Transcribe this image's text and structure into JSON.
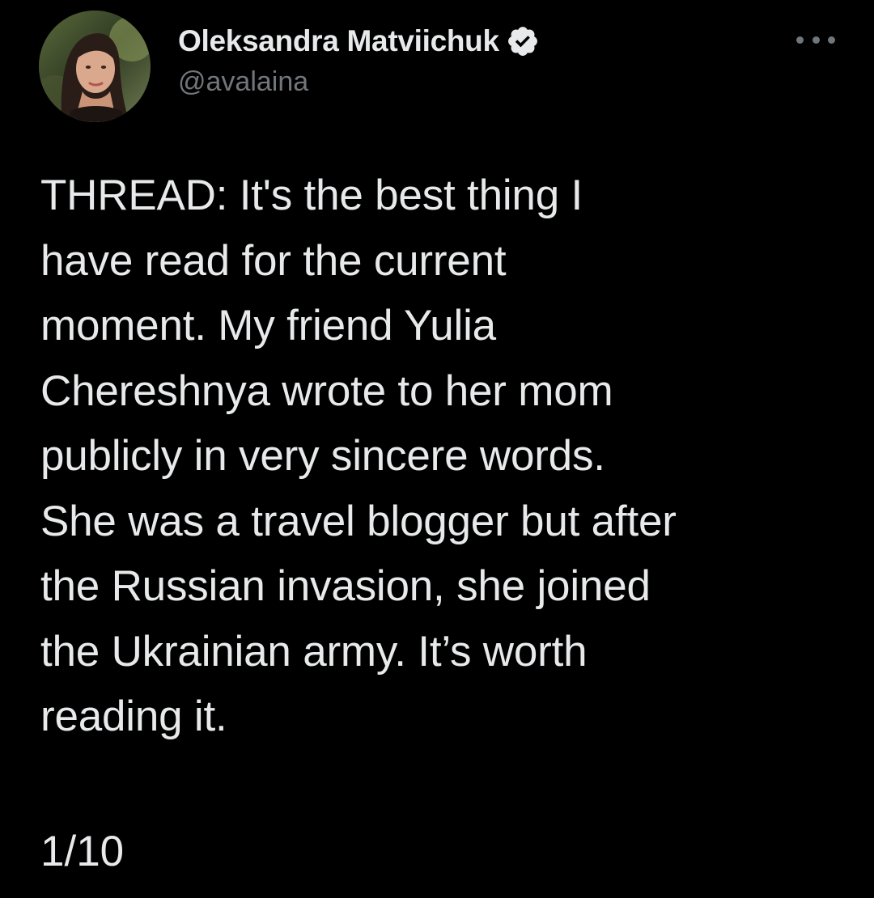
{
  "author": {
    "display_name": "Oleksandra Matviichuk",
    "handle": "@avalaina",
    "verified": true,
    "avatar_icon": "profile-photo"
  },
  "menu": {
    "icon": "more-options-icon"
  },
  "tweet": {
    "text": "THREAD: It's the best thing I\nhave read for the current\nmoment. My friend Yulia\nChereshnya wrote to her mom\npublicly in very sincere words.\nShe was a travel blogger but after\nthe Russian invasion, she joined\nthe Ukrainian army. It’s worth\nreading it.",
    "thread_position": "1/10"
  },
  "colors": {
    "background": "#000000",
    "primary_text": "#e7e9ea",
    "secondary_text": "#71767b",
    "verified_badge": "#e7e9ea"
  }
}
